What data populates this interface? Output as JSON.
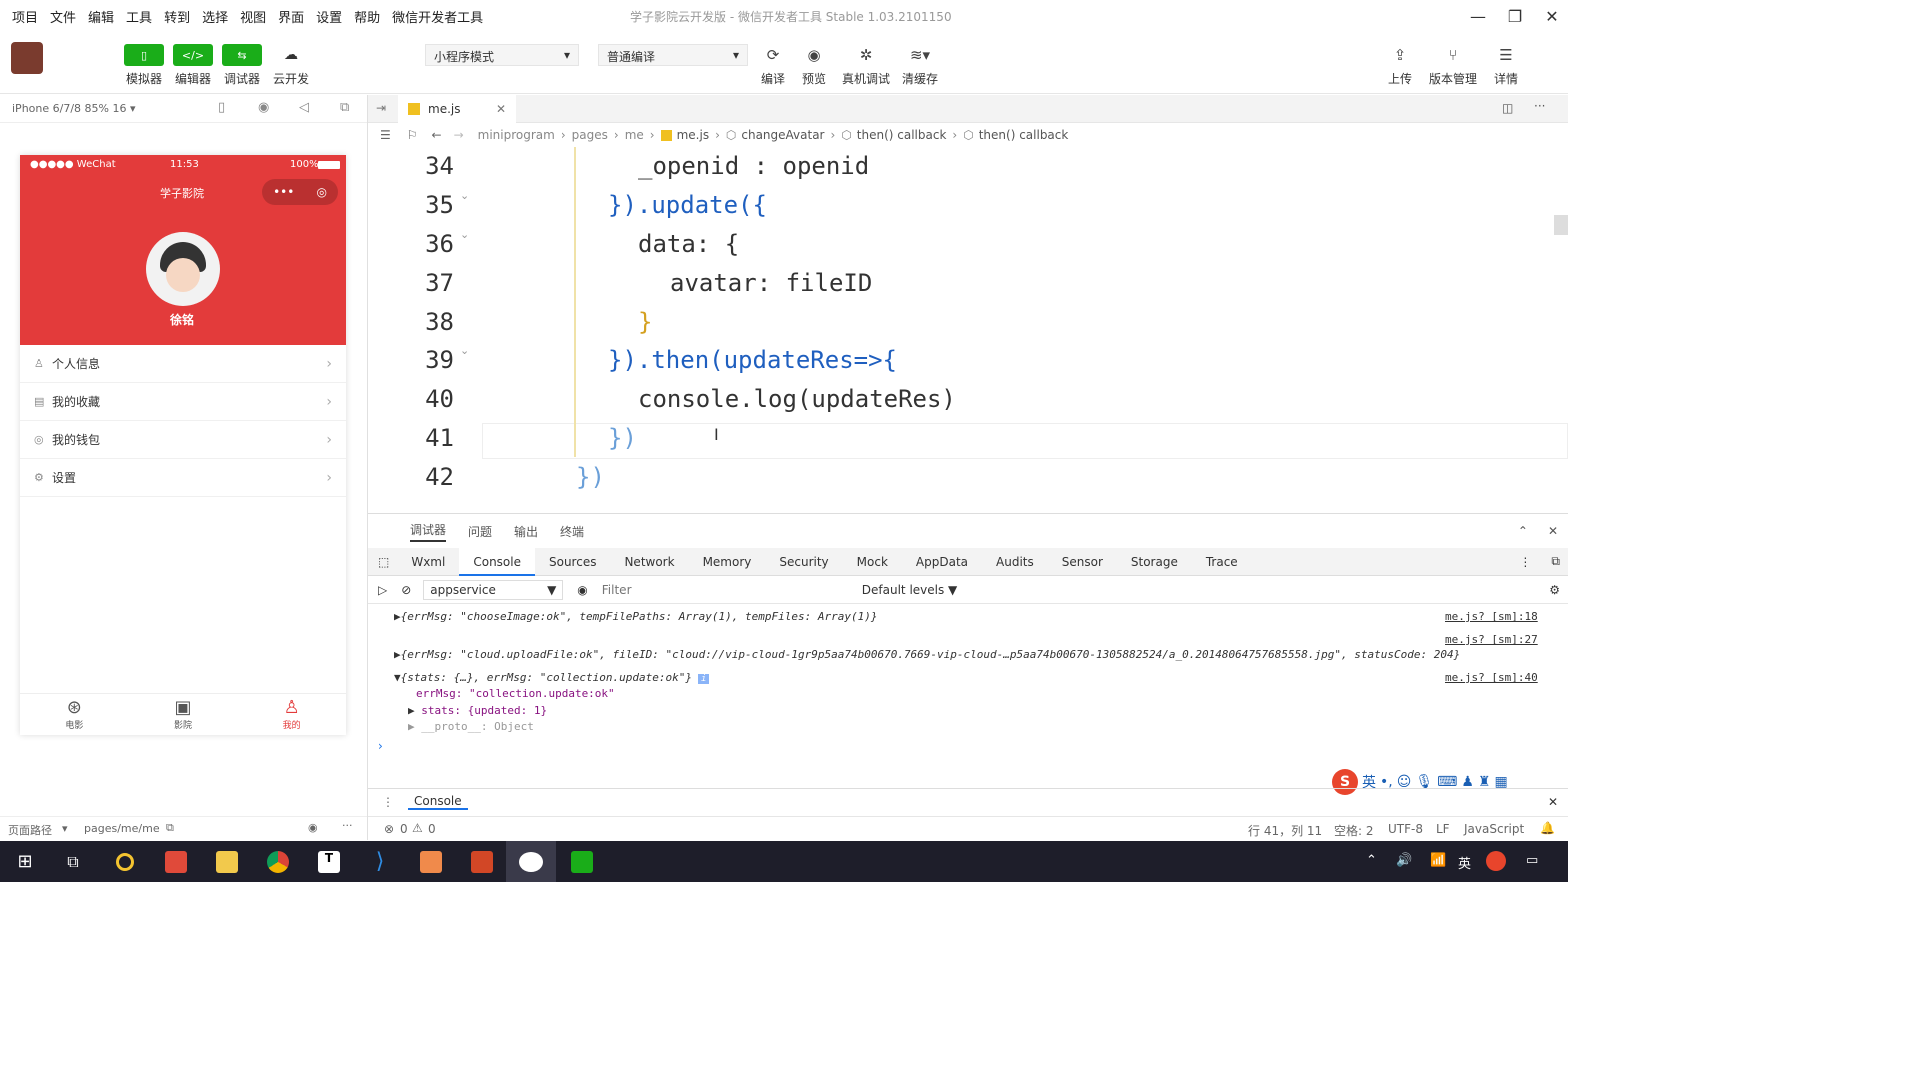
{
  "menu": [
    "项目",
    "文件",
    "编辑",
    "工具",
    "转到",
    "选择",
    "视图",
    "界面",
    "设置",
    "帮助",
    "微信开发者工具"
  ],
  "window_title": "学子影院云开发版 - 微信开发者工具 Stable 1.03.2101150",
  "toolbar": {
    "simulator": "模拟器",
    "editor": "编辑器",
    "debugger": "调试器",
    "cloud": "云开发",
    "mode_select": "小程序模式",
    "compile_select": "普通编译",
    "compile": "编译",
    "preview": "预览",
    "real_debug": "真机调试",
    "clear_cache": "清缓存",
    "upload": "上传",
    "version": "版本管理",
    "details": "详情"
  },
  "simulator": {
    "device": "iPhone 6/7/8 85% 16 ▾",
    "status_carrier": "●●●●● WeChat",
    "status_time": "11:53",
    "status_battery": "100%",
    "nav_title": "学子影院",
    "username": "徐铭",
    "menu_items": [
      {
        "icon": "user-icon",
        "label": "个人信息"
      },
      {
        "icon": "favorites-icon",
        "label": "我的收藏"
      },
      {
        "icon": "wallet-icon",
        "label": "我的钱包"
      },
      {
        "icon": "settings-icon",
        "label": "设置"
      }
    ],
    "tabs": [
      {
        "icon": "film-reel-icon",
        "label": "电影",
        "active": false
      },
      {
        "icon": "cinema-icon",
        "label": "影院",
        "active": false
      },
      {
        "icon": "profile-icon",
        "label": "我的",
        "active": true
      }
    ],
    "footer_path_label": "页面路径",
    "footer_path": "pages/me/me"
  },
  "editor": {
    "file_tab": "me.js",
    "breadcrumb": [
      "miniprogram",
      "pages",
      "me",
      "me.js",
      "changeAvatar",
      "then() callback",
      "then() callback"
    ],
    "lines": [
      {
        "n": "34",
        "code": "_openid : openid"
      },
      {
        "n": "35",
        "code": "}).update({"
      },
      {
        "n": "36",
        "code": "data: {"
      },
      {
        "n": "37",
        "code": "avatar: fileID"
      },
      {
        "n": "38",
        "code": "}"
      },
      {
        "n": "39",
        "code": "}).then(updateRes=>{"
      },
      {
        "n": "40",
        "code": "console.log(updateRes)"
      },
      {
        "n": "41",
        "code": "})"
      },
      {
        "n": "42",
        "code": "})"
      }
    ]
  },
  "panel": {
    "tabs": [
      "调试器",
      "问题",
      "输出",
      "终端"
    ],
    "devtools_tabs": [
      "Wxml",
      "Console",
      "Sources",
      "Network",
      "Memory",
      "Security",
      "Mock",
      "AppData",
      "Audits",
      "Sensor",
      "Storage",
      "Trace"
    ],
    "active_devtools_tab": "Console",
    "context": "appservice",
    "filter_placeholder": "Filter",
    "levels": "Default levels ▼",
    "logs": [
      {
        "text": "{errMsg: \"chooseImage:ok\", tempFilePaths: Array(1), tempFiles: Array(1)}",
        "src": "me.js? [sm]:18"
      },
      {
        "text": "",
        "src": "me.js? [sm]:27"
      },
      {
        "text": "{errMsg: \"cloud.uploadFile:ok\", fileID: \"cloud://vip-cloud-1gr9p5aa74b00670.7669-vip-cloud-…p5aa74b00670-1305882524/a_0.20148064757685558.jpg\", statusCode: 204}",
        "src": ""
      },
      {
        "text": "{stats: {…}, errMsg: \"collection.update:ok\"}",
        "src": "me.js? [sm]:40"
      },
      {
        "text": "errMsg: \"collection.update:ok\"",
        "src": ""
      },
      {
        "text": "stats: {updated: 1}",
        "src": ""
      },
      {
        "text": "__proto__: Object",
        "src": ""
      }
    ],
    "console_drawer": "Console"
  },
  "status": {
    "errors": "0",
    "warnings": "0",
    "position": "行 41，列 11",
    "spaces": "空格: 2",
    "encoding": "UTF-8",
    "eol": "LF",
    "language": "JavaScript"
  },
  "colors": {
    "accent_green": "#1aad19",
    "phone_red": "#e33b3b",
    "taskbar": "#1e1e2a"
  }
}
